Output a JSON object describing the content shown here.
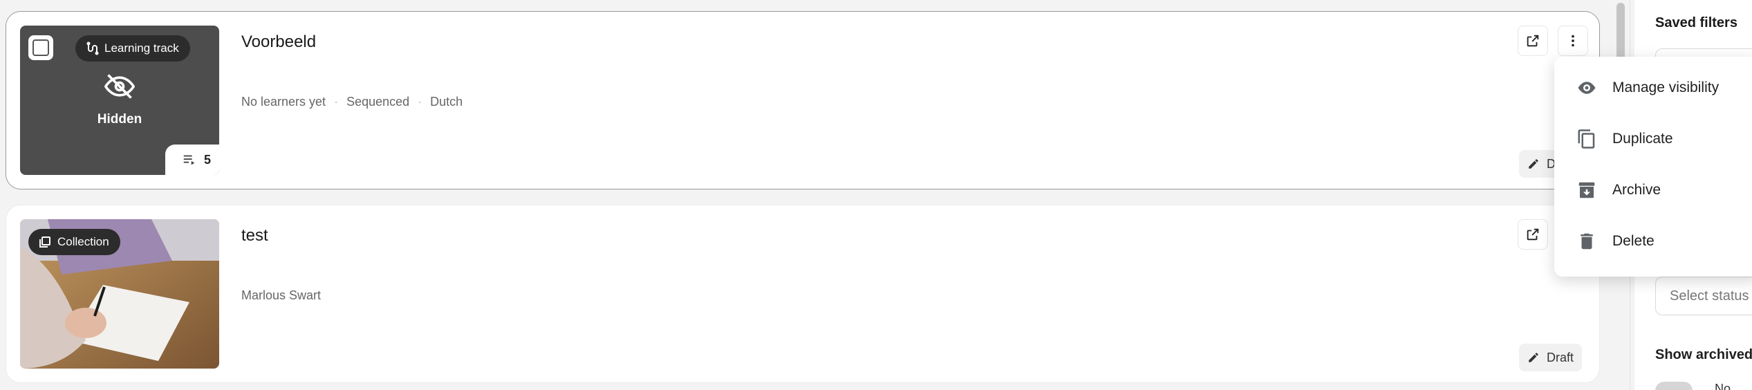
{
  "cards": [
    {
      "title": "Voorbeeld",
      "type_label": "Learning track",
      "thumbnail_state": "Hidden",
      "item_count": "5",
      "meta": [
        "No learners yet",
        "Sequenced",
        "Dutch"
      ],
      "status": "Draft",
      "status_visible": "D"
    },
    {
      "title": "test",
      "type_label": "Collection",
      "meta": [
        "Marlous Swart"
      ],
      "status": "Draft"
    }
  ],
  "menu": {
    "items": [
      {
        "label": "Manage visibility",
        "icon": "eye-icon"
      },
      {
        "label": "Duplicate",
        "icon": "copy-icon"
      },
      {
        "label": "Archive",
        "icon": "archive-icon"
      },
      {
        "label": "Delete",
        "icon": "trash-icon"
      }
    ]
  },
  "filters": {
    "title": "Saved filters",
    "status_placeholder": "Select status",
    "show_archived": "Show archived",
    "toggle_label": "No"
  }
}
